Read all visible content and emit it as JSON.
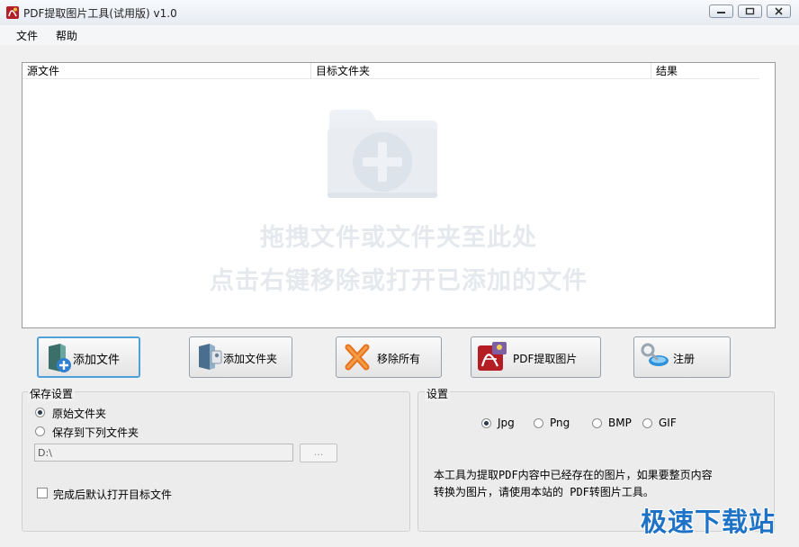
{
  "window": {
    "title": "PDF提取图片工具(试用版) v1.0",
    "accent_color": "#4fa0d8"
  },
  "menu": {
    "items": [
      "文件",
      "帮助"
    ]
  },
  "file_list": {
    "columns": [
      "源文件",
      "目标文件夹",
      "结果"
    ],
    "rows": [],
    "hint_line_1": "拖拽文件或文件夹至此处",
    "hint_line_2": "点击右键移除或打开已添加的文件",
    "drop_icon": "folder-plus-icon"
  },
  "toolbar": {
    "add_file": "添加文件",
    "add_folder": "添加文件夹",
    "remove_all": "移除所有",
    "extract": "PDF提取图片",
    "register": "注册"
  },
  "save_settings": {
    "title": "保存设置",
    "option_original": "原始文件夹",
    "option_custom": "保存到下列文件夹",
    "selected": "原始文件夹",
    "path_value": "D:\\",
    "browse_label": "...",
    "open_after_label": "完成后默认打开目标文件",
    "open_after_checked": false
  },
  "settings": {
    "title": "设置",
    "formats": [
      "Jpg",
      "Png",
      "BMP",
      "GIF"
    ],
    "selected_format": "Jpg",
    "description_line_1": "本工具为提取PDF内容中已经存在的图片，如果要整页内容",
    "description_line_2": "转换为图片，请使用本站的 PDF转图片工具。"
  },
  "watermark": {
    "text": "极速下载站",
    "color": "#1e73c7"
  }
}
